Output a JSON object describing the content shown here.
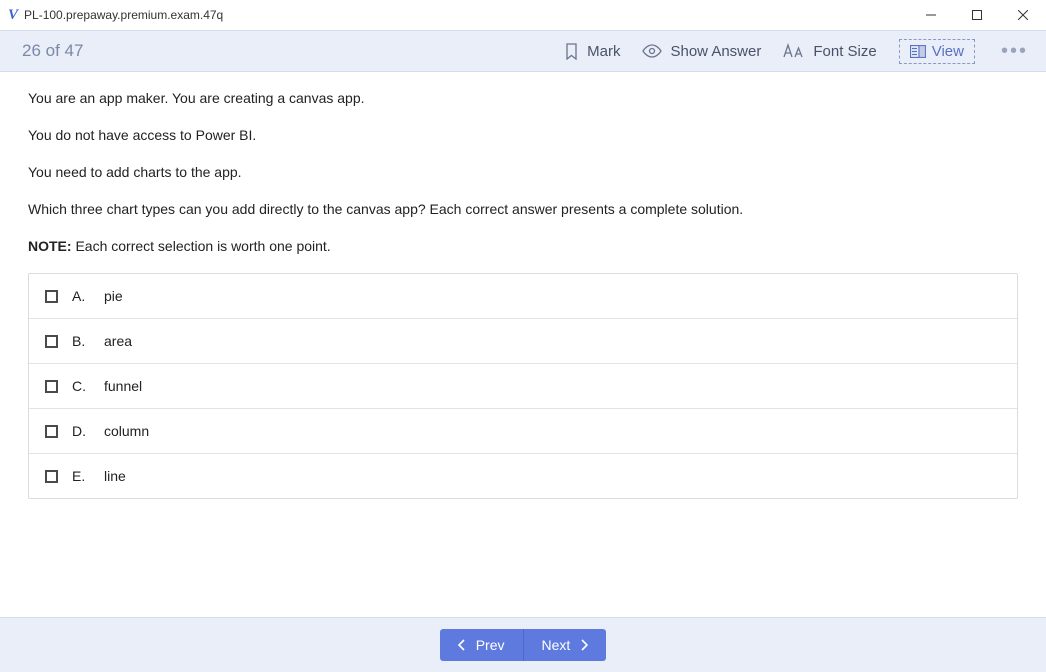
{
  "window": {
    "title": "PL-100.prepaway.premium.exam.47q"
  },
  "toolbar": {
    "counter": "26 of 47",
    "mark": "Mark",
    "show_answer": "Show Answer",
    "font_size": "Font Size",
    "view": "View"
  },
  "question": {
    "p1": "You are an app maker. You are creating a canvas app.",
    "p2": "You do not have access to Power BI.",
    "p3": "You need to add charts to the app.",
    "p4": "Which three chart types can you add directly to the canvas app? Each correct answer presents a complete solution.",
    "note_label": "NOTE:",
    "note_text": " Each correct selection is worth one point."
  },
  "options": [
    {
      "letter": "A.",
      "text": "pie"
    },
    {
      "letter": "B.",
      "text": "area"
    },
    {
      "letter": "C.",
      "text": "funnel"
    },
    {
      "letter": "D.",
      "text": "column"
    },
    {
      "letter": "E.",
      "text": "line"
    }
  ],
  "nav": {
    "prev": "Prev",
    "next": "Next"
  }
}
